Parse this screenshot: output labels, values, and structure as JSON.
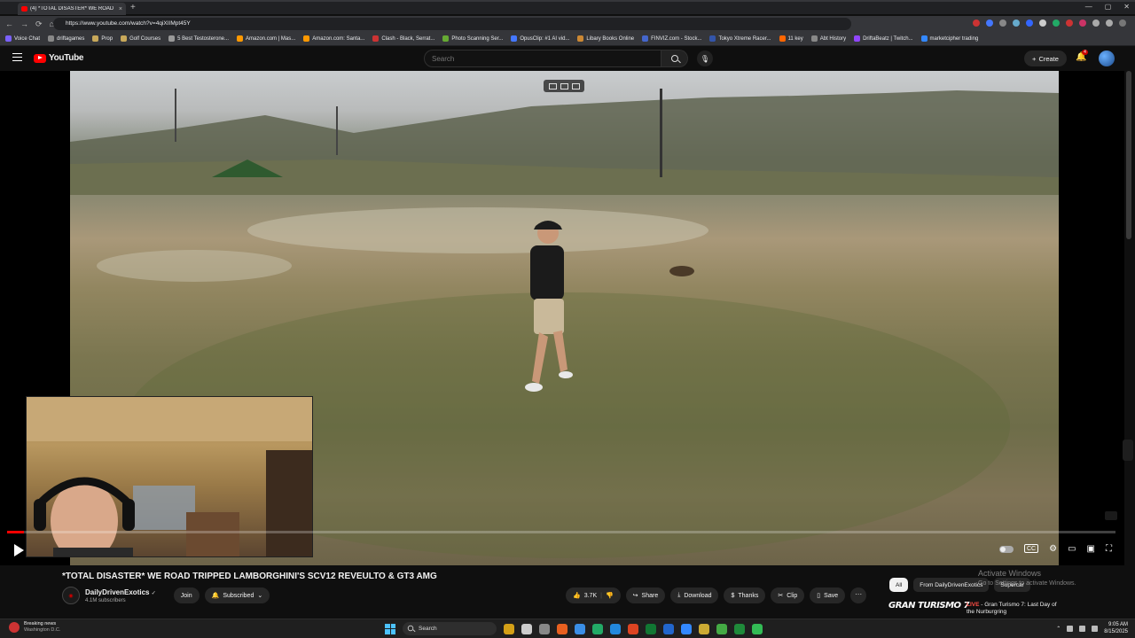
{
  "browser": {
    "tab_title": "(4) *TOTAL DISASTER* WE ROAD",
    "tab_close": "×",
    "new_tab": "+",
    "url": "https://www.youtube.com/watch?v=4qiXIIMpt45Y",
    "window_controls": [
      "—",
      "▢",
      "✕"
    ],
    "nav": [
      "←",
      "→",
      "⟳",
      "⌂"
    ],
    "bookmarks": [
      {
        "label": "Voice Chat",
        "color": "#7b61ff"
      },
      {
        "label": "driftagames",
        "color": "#888888"
      },
      {
        "label": "Prop",
        "color": "#c8a85a"
      },
      {
        "label": "Golf Courses",
        "color": "#c8a85a"
      },
      {
        "label": "5 Best Testosterone...",
        "color": "#999999"
      },
      {
        "label": "Amazon.com | Mas...",
        "color": "#ff9900"
      },
      {
        "label": "Amazon.com: Santa...",
        "color": "#ff9900"
      },
      {
        "label": "Clash - Black, Serrat...",
        "color": "#cc3333"
      },
      {
        "label": "Photo Scanning Ser...",
        "color": "#66aa33"
      },
      {
        "label": "OpusClip: #1 AI vid...",
        "color": "#4477ff"
      },
      {
        "label": "Libary Books Online",
        "color": "#cc8833"
      },
      {
        "label": "FINVIZ.com - Stock...",
        "color": "#4466cc"
      },
      {
        "label": "Tokyo Xtreme Racer...",
        "color": "#3355aa"
      },
      {
        "label": "11 key",
        "color": "#ff6600"
      },
      {
        "label": "Abt History",
        "color": "#888888"
      },
      {
        "label": "DriftaBeatz | Twitch...",
        "color": "#9146ff"
      },
      {
        "label": "marketcipher trading",
        "color": "#3388ff"
      }
    ],
    "extension_colors": [
      "#cc3333",
      "#4477ff",
      "#888888",
      "#66aacc",
      "#3366ff",
      "#cccccc",
      "#22aa66",
      "#cc3333",
      "#cc3366",
      "#aaaaaa",
      "#aaaaaa",
      "#777777"
    ]
  },
  "youtube": {
    "logo": "YouTube",
    "search_placeholder": "Search",
    "mic_icon": "🎙",
    "create_label": "Create",
    "bell_icon": "🔔",
    "notification_count": "4"
  },
  "player": {
    "progress_fraction": 0.015,
    "right_controls": [
      "⚙",
      "▭",
      "▣",
      "⛶"
    ],
    "cc_label": "CC"
  },
  "video": {
    "title": "*TOTAL DISASTER* WE ROAD TRIPPED LAMBORGHINI'S SCV12 REVEULTO & GT3 AMG",
    "channel": "DailyDrivenExotics",
    "verified": "✓",
    "subscribers": "4.1M subscribers",
    "join_label": "Join",
    "subscribed_label": "Subscribed",
    "subscribed_chevron": "⌄",
    "likes": "3.7K",
    "share_label": "Share",
    "download_label": "Download",
    "thanks_label": "Thanks",
    "clip_label": "Clip",
    "save_label": "Save",
    "more_label": "···"
  },
  "chips": [
    "All",
    "From DailyDrivenExotics",
    "Supercar"
  ],
  "watermark": {
    "title": "Activate Windows",
    "subtitle": "Go to Settings to activate Windows."
  },
  "recommendation": {
    "thumb_text": "GRAN TURISMO 7",
    "live_badge": "LIVE",
    "title": " - Gran Turismo 7: Last Day of the Nurburgring"
  },
  "taskbar": {
    "news_title": "Breaking news",
    "news_subtitle": "Washington D.C.",
    "search_label": "Search",
    "time": "9:05 AM",
    "date": "8/15/2025",
    "app_colors": [
      "#d4a017",
      "#cccccc",
      "#888888",
      "#e86020",
      "#3a8ee6",
      "#22aa66",
      "#2288dd",
      "#dd4422",
      "#117733",
      "#2266cc",
      "#3388ff",
      "#ccaa33",
      "#44aa44",
      "#1f8a3a",
      "#33bb55"
    ]
  }
}
